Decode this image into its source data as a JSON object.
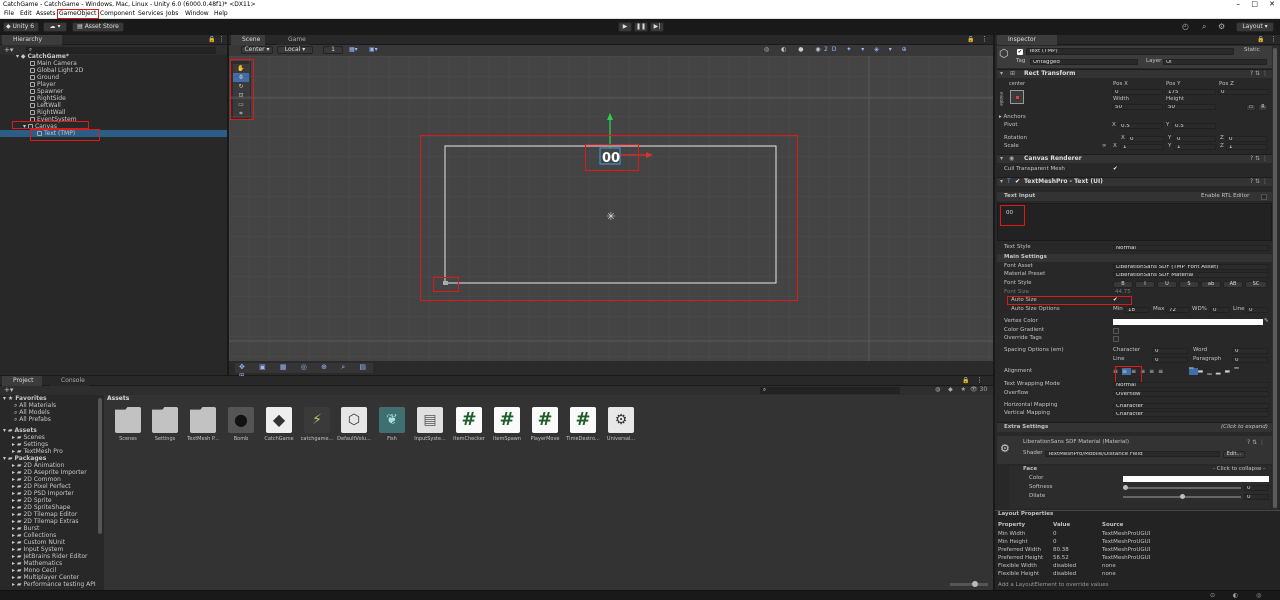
{
  "window": {
    "title": "CatchGame - CatchGame - Windows, Mac, Linux - Unity 6.0 (6000.0.48f1)* <DX11>"
  },
  "menu": [
    "File",
    "Edit",
    "Assets",
    "GameObject",
    "Component",
    "Services",
    "Jobs",
    "Window",
    "Help"
  ],
  "toolbar": {
    "account": "Unity 6",
    "asset_store": "Asset Store",
    "layout": "Layout"
  },
  "hierarchy": {
    "tab": "Hierarchy",
    "search_placeholder": "All",
    "scene": "CatchGame*",
    "items": [
      "Main Camera",
      "Global Light 2D",
      "Ground",
      "Player",
      "Spawner",
      "RightSide",
      "LeftWall",
      "RightWall",
      "EventSystem",
      "Canvas",
      "Text (TMP)"
    ]
  },
  "scene": {
    "tabs": [
      "Scene",
      "Game"
    ],
    "pivot": "Center",
    "space": "Local",
    "grid_snap": "1",
    "text_label": "00"
  },
  "project": {
    "tabs": [
      "Project",
      "Console"
    ],
    "favorites": {
      "header": "Favorites",
      "items": [
        "All Materials",
        "All Models",
        "All Prefabs"
      ]
    },
    "assets": {
      "header": "Assets",
      "items": [
        "Scenes",
        "Settings",
        "TextMesh Pro"
      ]
    },
    "packages": {
      "header": "Packages",
      "items": [
        "2D Animation",
        "2D Aseprite Importer",
        "2D Common",
        "2D Pixel Perfect",
        "2D PSD Importer",
        "2D Sprite",
        "2D SpriteShape",
        "2D Tilemap Editor",
        "2D Tilemap Extras",
        "Burst",
        "Collections",
        "Custom NUnit",
        "Input System",
        "JetBrains Rider Editor",
        "Mathematics",
        "Mono Cecil",
        "Multiplayer Center",
        "Performance testing API"
      ]
    },
    "breadcrumb": "Assets",
    "count": "30",
    "grid": [
      "Scenes",
      "Settings",
      "TextMesh P...",
      "Bomb",
      "CatchGame",
      "catchgame...",
      "DefaultVolu...",
      "Fish",
      "InputSyste...",
      "ItemChecker",
      "ItemSpawn",
      "PlayerMove",
      "TimeDestro...",
      "Universal..."
    ]
  },
  "inspector": {
    "tab": "Inspector",
    "object_name": "Text (TMP)",
    "static": "Static",
    "tag_label": "Tag",
    "tag": "Untagged",
    "layer_label": "Layer",
    "layer": "UI",
    "rect": {
      "title": "Rect Transform",
      "anchor_label": "center",
      "side_label": "middle",
      "pos_x_label": "Pos X",
      "pos_y_label": "Pos Y",
      "pos_z_label": "Pos Z",
      "pos_x": "0",
      "pos_y": "175",
      "pos_z": "0",
      "width_label": "Width",
      "height_label": "Height",
      "width": "50",
      "height": "50",
      "anchors": "Anchors",
      "pivot_label": "Pivot",
      "pivot_x": "0.5",
      "pivot_y": "0.5",
      "rotation_label": "Rotation",
      "rot_x": "0",
      "rot_y": "0",
      "rot_z": "0",
      "scale_label": "Scale",
      "scale_x": "1",
      "scale_y": "1",
      "scale_z": "1"
    },
    "canvas_renderer": {
      "title": "Canvas Renderer",
      "cull": "Cull Transparent Mesh"
    },
    "tmp": {
      "title": "TextMeshPro - Text (UI)",
      "text_input": "Text Input",
      "rtl": "Enable RTL Editor",
      "text": "00",
      "text_style_label": "Text Style",
      "text_style": "Normal",
      "main_settings": "Main Settings",
      "font_asset_label": "Font Asset",
      "font_asset": "LiberationSans SDF (TMP_Font Asset)",
      "material_preset_label": "Material Preset",
      "material_preset": "LiberationSans SDF Material",
      "font_style_label": "Font Style",
      "font_styles": [
        "B",
        "I",
        "U",
        "S",
        "ab",
        "AB",
        "SC"
      ],
      "font_size_label": "Font Size",
      "font_size": "44.75",
      "auto_size_label": "Auto Size",
      "auto_size_options_label": "Auto Size Options",
      "min_label": "Min",
      "min": "18",
      "max_label": "Max",
      "max": "72",
      "wd_label": "WD%",
      "wd": "0",
      "line_label": "Line",
      "line": "0",
      "vertex_color_label": "Vertex Color",
      "color_gradient_label": "Color Gradient",
      "override_tags_label": "Override Tags",
      "spacing_label": "Spacing Options (em)",
      "character_label": "Character",
      "character": "0",
      "word_label": "Word",
      "word": "0",
      "line2_label": "Line",
      "line2": "0",
      "paragraph_label": "Paragraph",
      "paragraph": "0",
      "alignment_label": "Alignment",
      "wrap_label": "Text Wrapping Mode",
      "wrap": "Normal",
      "overflow_label": "Overflow",
      "overflow": "Overflow",
      "hmap_label": "Horizontal Mapping",
      "hmap": "Character",
      "vmap_label": "Vertical Mapping",
      "vmap": "Character",
      "extra_settings": "Extra Settings",
      "click_expand": "(Click to expand)"
    },
    "material": {
      "title": "LiberationSans SDF Material (Material)",
      "shader_label": "Shader",
      "shader": "TextMeshPro/Mobile/Distance Field",
      "edit": "Edit...",
      "face": "Face",
      "collapse": "- Click to collapse -",
      "color_label": "Color",
      "softness_label": "Softness",
      "softness": "0",
      "dilate_label": "Dilate",
      "dilate": "0"
    },
    "layout_props": {
      "title": "Layout Properties",
      "headers": [
        "Property",
        "Value",
        "Source"
      ],
      "rows": [
        [
          "Min Width",
          "0",
          "TextMeshProUGUI"
        ],
        [
          "Min Height",
          "0",
          "TextMeshProUGUI"
        ],
        [
          "Preferred Width",
          "80.38",
          "TextMeshProUGUI"
        ],
        [
          "Preferred Height",
          "56.52",
          "TextMeshProUGUI"
        ],
        [
          "Flexible Width",
          "disabled",
          "none"
        ],
        [
          "Flexible Height",
          "disabled",
          "none"
        ]
      ],
      "footer": "Add a LayoutElement to override values"
    }
  }
}
